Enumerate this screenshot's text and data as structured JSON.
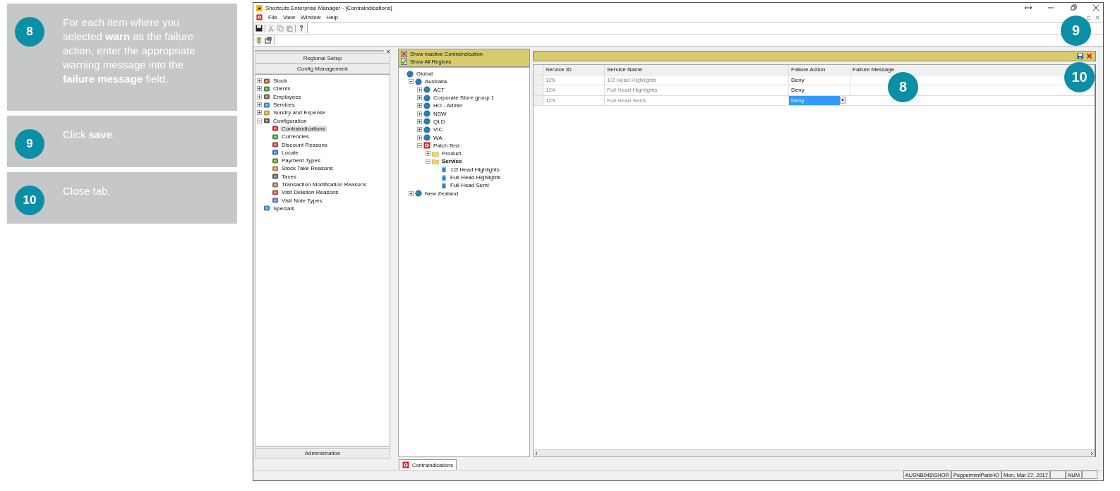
{
  "steps": [
    {
      "number": "8",
      "text": "For each item where you selected **warn** as the failure action, enter the appropriate warning message into the **failure message** field."
    },
    {
      "number": "9",
      "text": "Click **save**."
    },
    {
      "number": "10",
      "text": "Close tab."
    }
  ],
  "window": {
    "title": "Shortcuts Enterprise Manager - [Contraindications]",
    "menu": [
      "File",
      "View",
      "Window",
      "Help"
    ]
  },
  "left_panel": {
    "buttons": [
      "Regional Setup",
      "Config Management"
    ],
    "tree": [
      {
        "label": "Stock",
        "expanded": false,
        "selected": false
      },
      {
        "label": "Clients",
        "expanded": false,
        "selected": false
      },
      {
        "label": "Employees",
        "expanded": false,
        "selected": false
      },
      {
        "label": "Services",
        "expanded": false,
        "selected": false
      },
      {
        "label": "Sundry and Expense",
        "expanded": false,
        "selected": false
      },
      {
        "label": "Configuration",
        "expanded": true,
        "selected": false,
        "children": [
          {
            "label": "Contraindications",
            "selected": true
          },
          {
            "label": "Currencies",
            "selected": false
          },
          {
            "label": "Discount Reasons",
            "selected": false
          },
          {
            "label": "Locale",
            "selected": false
          },
          {
            "label": "Payment Types",
            "selected": false
          },
          {
            "label": "Stock Take Reasons",
            "selected": false
          },
          {
            "label": "Taxes",
            "selected": false
          },
          {
            "label": "Transaction Modification Reasons",
            "selected": false
          },
          {
            "label": "Visit Deletion Reasons",
            "selected": false
          },
          {
            "label": "Visit Note Types",
            "selected": false
          }
        ]
      },
      {
        "label": "Specials",
        "selected": false
      }
    ],
    "footer_button": "Administration"
  },
  "middle_panel": {
    "options": [
      {
        "label": "Show Inactive Contraindication",
        "checked": false
      },
      {
        "label": "Show All Regions",
        "checked": true
      }
    ],
    "tree": [
      {
        "label": "Global",
        "kind": "region",
        "selected": false,
        "children": [
          {
            "label": "Australia",
            "kind": "region",
            "expanded": true,
            "selected": false,
            "children": [
              {
                "label": "ACT",
                "kind": "region",
                "expanded": false,
                "selected": false
              },
              {
                "label": "Corporate Store group 1",
                "kind": "region",
                "expanded": false,
                "selected": false
              },
              {
                "label": "HO - Admin",
                "kind": "region",
                "expanded": false,
                "selected": false
              },
              {
                "label": "NSW",
                "kind": "region",
                "expanded": false,
                "selected": false
              },
              {
                "label": "QLD",
                "kind": "region",
                "expanded": false,
                "selected": false
              },
              {
                "label": "VIC",
                "kind": "region",
                "expanded": false,
                "selected": false
              },
              {
                "label": "WA",
                "kind": "region",
                "expanded": false,
                "selected": false
              },
              {
                "label": "Patch Test",
                "kind": "contraindication",
                "expanded": true,
                "selected": false,
                "children": [
                  {
                    "label": "Product",
                    "kind": "folder",
                    "expanded": false,
                    "selected": false
                  },
                  {
                    "label": "Service",
                    "kind": "folder",
                    "expanded": true,
                    "selected": true,
                    "children": [
                      {
                        "label": "1/2 Head Highlights",
                        "kind": "service",
                        "selected": false
                      },
                      {
                        "label": "Full Head Highlights",
                        "kind": "service",
                        "selected": false
                      },
                      {
                        "label": "Full Head Semi",
                        "kind": "service",
                        "selected": false
                      }
                    ]
                  }
                ]
              }
            ]
          },
          {
            "label": "New Zealand",
            "kind": "region",
            "expanded": false,
            "selected": false
          }
        ]
      }
    ]
  },
  "grid": {
    "columns": [
      "Service ID",
      "Service Name",
      "Failure Action",
      "Failure Message"
    ],
    "rows": [
      {
        "cells": [
          "126",
          "1/2 Head Highlights",
          "Deny"
        ],
        "selected": false
      },
      {
        "cells": [
          "124",
          "Full Head Highlights",
          "Deny"
        ],
        "selected": false
      },
      {
        "cells": [
          "125",
          "Full Head Semi",
          "Deny"
        ],
        "selected": true
      }
    ]
  },
  "tabs": [
    {
      "label": "Contraindications",
      "selected": true
    }
  ],
  "status_bar": [
    "AUSNB048\\SHOR",
    "PeppermintParkHO",
    "Mon, Mar 27, 2017",
    "NUM"
  ],
  "callouts": [
    "9",
    "10",
    "8"
  ]
}
